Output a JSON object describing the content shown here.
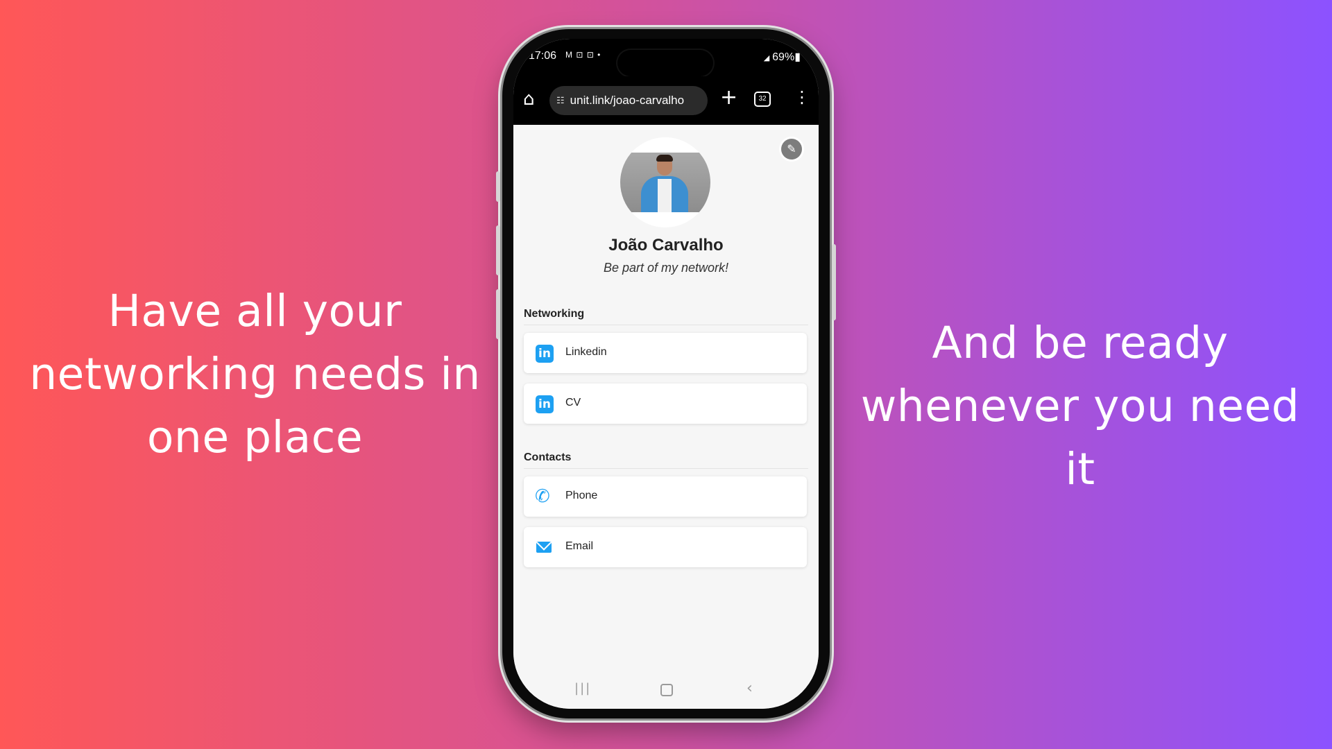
{
  "promo": {
    "left_line1": "Have all your",
    "left_line2": "networking needs in",
    "left_line3": "one place",
    "right_line1": "And be ready",
    "right_line2": "whenever you need it"
  },
  "statusbar": {
    "time": "17:06",
    "notif_icons": "M ⊡ ⊡ •",
    "battery": "69%"
  },
  "browser": {
    "url": "unit.link/joao-carvalho",
    "tab_count": "32"
  },
  "profile": {
    "name": "João Carvalho",
    "tagline": "Be part of my network!"
  },
  "sections": [
    {
      "title": "Networking",
      "items": [
        "Linkedin",
        "CV"
      ]
    },
    {
      "title": "Contacts",
      "items": [
        "Phone",
        "Email"
      ]
    }
  ],
  "icons": {
    "linkedin": "linkedin-icon",
    "phone": "phone-icon",
    "email": "mail-icon",
    "edit": "pencil-icon"
  },
  "colors": {
    "gradient_left": "#ff5757",
    "gradient_right": "#8c52ff",
    "accent": "#1da0f2"
  }
}
